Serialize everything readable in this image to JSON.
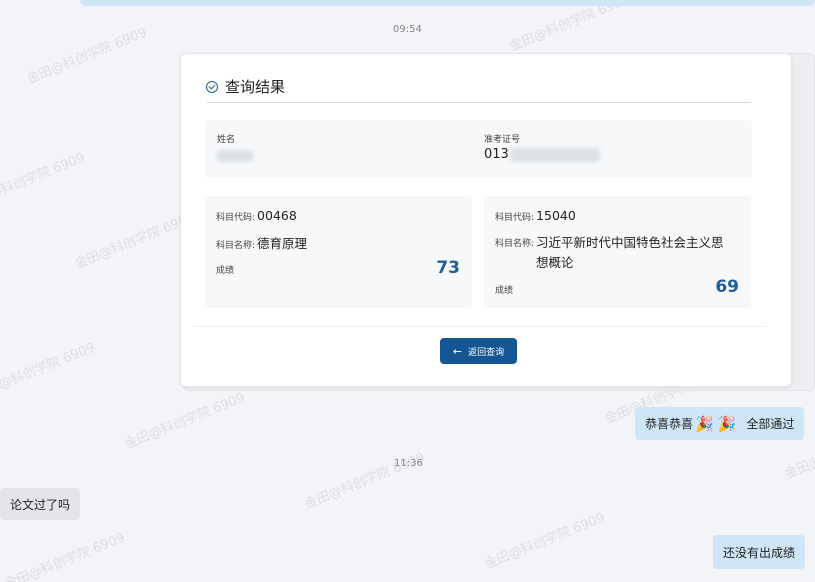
{
  "times": {
    "t1": "09:54",
    "t2": "11:36"
  },
  "card": {
    "title": "查询结果",
    "name_label": "姓名",
    "id_label": "准考证号",
    "id_value_prefix": "013",
    "subjects": [
      {
        "code_label": "科目代码:",
        "code": "00468",
        "name_label": "科目名称:",
        "name": "德育原理",
        "score_label": "成绩",
        "score": "73"
      },
      {
        "code_label": "科目代码:",
        "code": "15040",
        "name_label": "科目名称:",
        "name": "习近平新时代中国特色社会主义思想概论",
        "score_label": "成绩",
        "score": "69"
      }
    ],
    "back_button": "返回查询"
  },
  "messages": {
    "congrats_a": "恭喜恭喜",
    "congrats_b": "全部通过",
    "question": "论文过了吗",
    "answer": "还没有出成绩"
  },
  "watermark": "金田@科创学院 6909",
  "colors": {
    "accent": "#165594",
    "bubble_right": "#cfe5f8",
    "bubble_left": "#e4e5e8",
    "score": "#1d5e9a"
  }
}
